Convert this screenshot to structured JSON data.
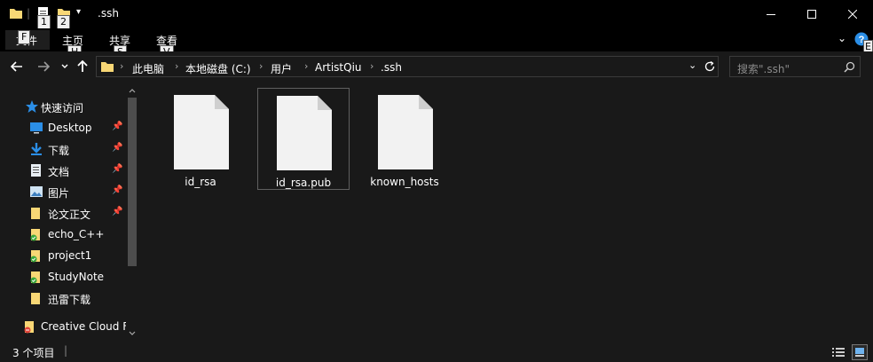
{
  "window": {
    "title": ".ssh",
    "keytips": {
      "qat1": "1",
      "qat2": "2",
      "file": "F",
      "home": "H",
      "share": "S",
      "view": "V",
      "help": "E"
    }
  },
  "ribbon": {
    "tabs": [
      {
        "label": "文件"
      },
      {
        "label": "主页"
      },
      {
        "label": "共享"
      },
      {
        "label": "查看"
      }
    ]
  },
  "address": {
    "crumbs": [
      "此电脑",
      "本地磁盘 (C:)",
      "用户",
      "ArtistQiu",
      ".ssh"
    ],
    "search_placeholder": "搜索\".ssh\""
  },
  "nav": {
    "quick_access_label": "快速访问",
    "items": [
      {
        "label": "Desktop",
        "icon": "desktop-icon",
        "pinned": true
      },
      {
        "label": "下载",
        "icon": "download-icon",
        "pinned": true
      },
      {
        "label": "文档",
        "icon": "document-icon",
        "pinned": true
      },
      {
        "label": "图片",
        "icon": "picture-icon",
        "pinned": true
      },
      {
        "label": "论文正文",
        "icon": "folder-icon",
        "pinned": true
      },
      {
        "label": "echo_C++",
        "icon": "folder-synced-icon",
        "pinned": false
      },
      {
        "label": "project1",
        "icon": "folder-synced-icon",
        "pinned": false
      },
      {
        "label": "StudyNote",
        "icon": "folder-synced-icon",
        "pinned": false
      },
      {
        "label": "迅雷下载",
        "icon": "folder-icon",
        "pinned": false
      }
    ],
    "creative_cloud_label": "Creative Cloud F"
  },
  "files": [
    {
      "name": "id_rsa",
      "selected": false
    },
    {
      "name": "id_rsa.pub",
      "selected": true
    },
    {
      "name": "known_hosts",
      "selected": false
    }
  ],
  "status": {
    "count_text": "3 个项目"
  },
  "colors": {
    "background": "#191919",
    "titlebar": "#000000",
    "folder_yellow": "#f8d775",
    "accent_blue": "#2b8ee6"
  }
}
